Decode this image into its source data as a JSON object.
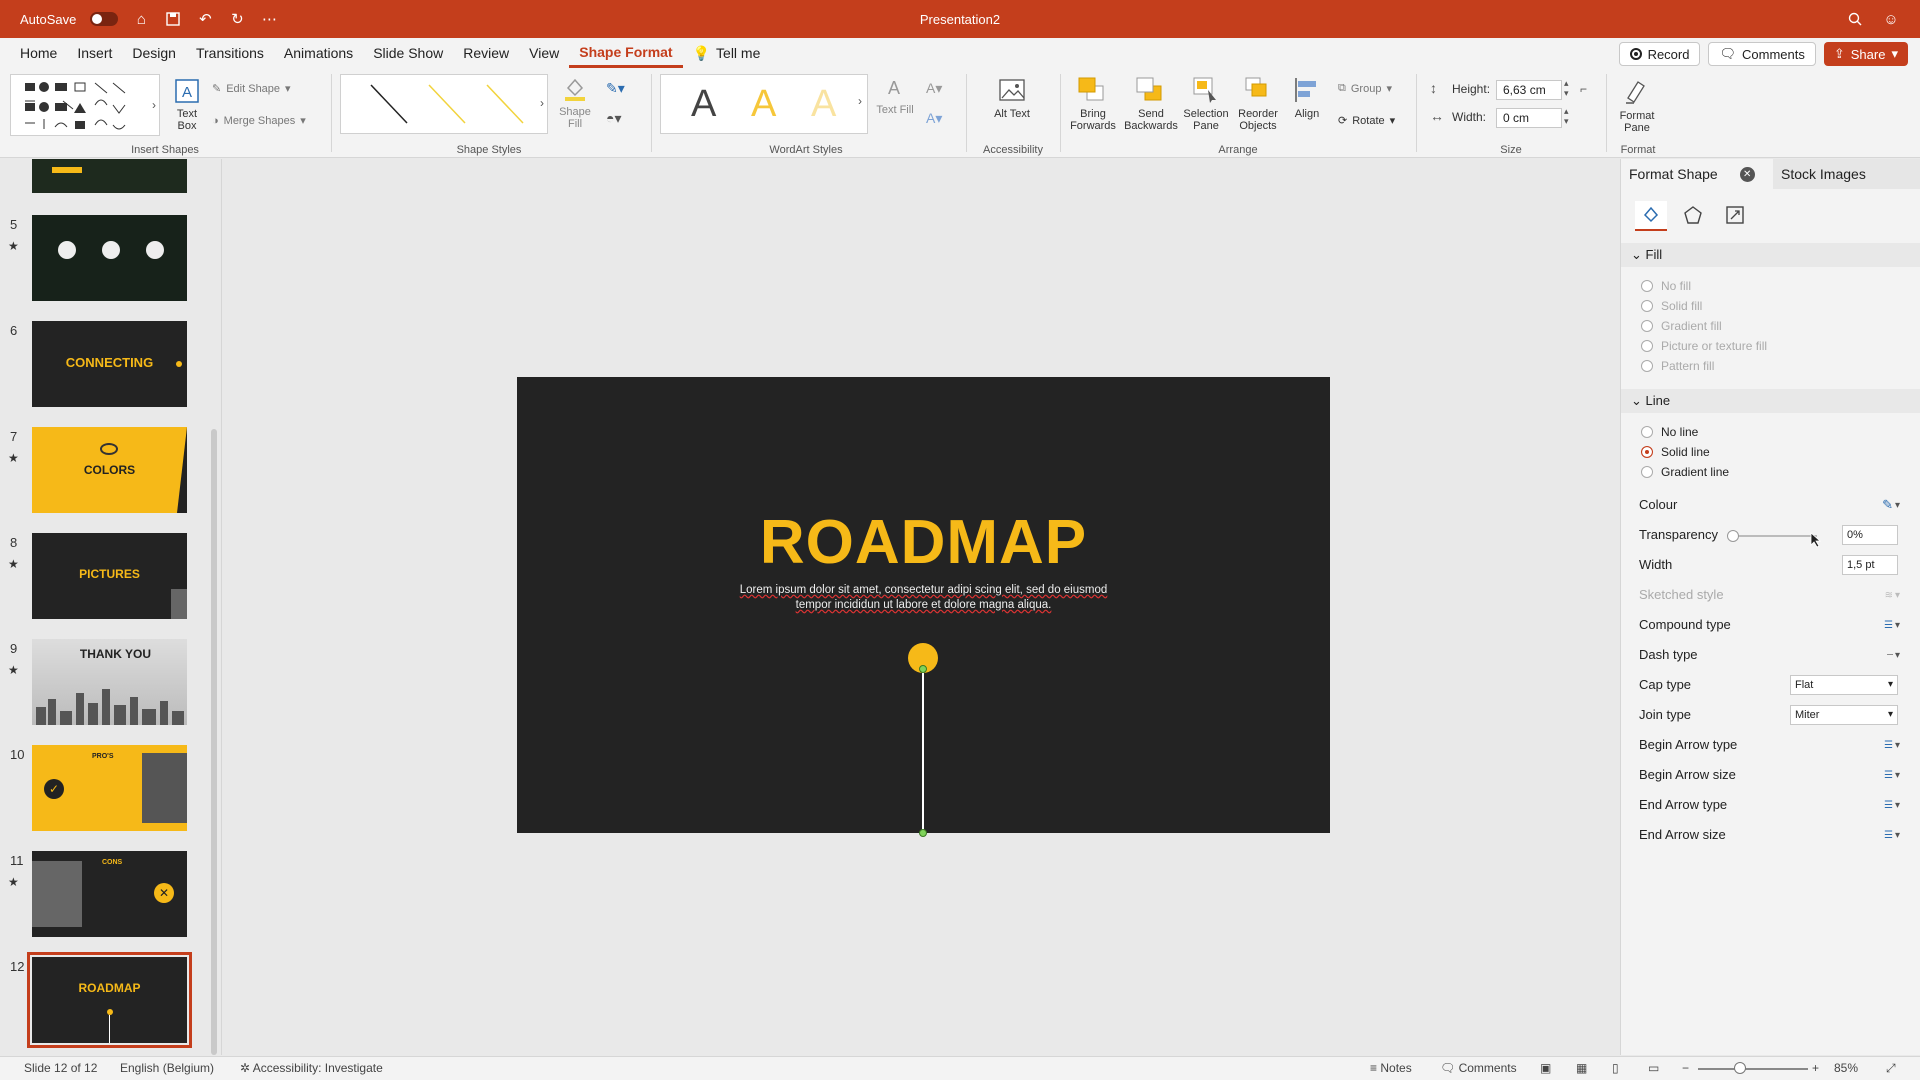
{
  "titlebar": {
    "autosave_label": "AutoSave",
    "doc_title": "Presentation2"
  },
  "tabs": [
    {
      "label": "Home"
    },
    {
      "label": "Insert"
    },
    {
      "label": "Design"
    },
    {
      "label": "Transitions"
    },
    {
      "label": "Animations"
    },
    {
      "label": "Slide Show"
    },
    {
      "label": "Review"
    },
    {
      "label": "View"
    },
    {
      "label": "Shape Format"
    }
  ],
  "tell_me": "Tell me",
  "actions": {
    "record": "Record",
    "comments": "Comments",
    "share": "Share"
  },
  "ribbon": {
    "insert_shapes": {
      "label": "Insert Shapes",
      "text_box": "Text Box",
      "edit_shape": "Edit Shape",
      "merge_shapes": "Merge Shapes"
    },
    "shape_styles": {
      "label": "Shape Styles",
      "shape_fill": "Shape Fill"
    },
    "wordart": {
      "label": "WordArt Styles",
      "text_fill": "Text Fill",
      "letter": "A"
    },
    "accessibility": {
      "label": "Accessibility",
      "alt_text": "Alt Text"
    },
    "arrange": {
      "label": "Arrange",
      "bring_forwards": "Bring Forwards",
      "send_backwards": "Send Backwards",
      "selection_pane": "Selection Pane",
      "reorder_objects": "Reorder Objects",
      "align": "Align",
      "group": "Group",
      "rotate": "Rotate"
    },
    "size": {
      "label": "Size",
      "height_label": "Height:",
      "height_value": "6,63 cm",
      "width_label": "Width:",
      "width_value": "0 cm"
    },
    "format": {
      "label": "Format",
      "format_pane": "Format Pane"
    }
  },
  "thumbnails": [
    {
      "num": "5",
      "star": true,
      "text": ""
    },
    {
      "num": "6",
      "star": false,
      "text": "CONNECTING"
    },
    {
      "num": "7",
      "star": true,
      "text": "COLORS"
    },
    {
      "num": "8",
      "star": true,
      "text": "PICTURES"
    },
    {
      "num": "9",
      "star": true,
      "text": "THANK YOU"
    },
    {
      "num": "10",
      "star": false,
      "text": "PRO'S"
    },
    {
      "num": "11",
      "star": true,
      "text": "CONS"
    },
    {
      "num": "12",
      "star": false,
      "text": "ROADMAP"
    }
  ],
  "slide": {
    "title": "ROADMAP",
    "body_1": "Lorem ipsum dolor sit amet, consectetur adipi scing elit, sed do eiusmod",
    "body_2": "tempor incididun ut labore et dolore magna aliqua."
  },
  "pane": {
    "title": "Format Shape",
    "stock": "Stock Images",
    "fill": {
      "header": "Fill",
      "options": [
        "No fill",
        "Solid fill",
        "Gradient fill",
        "Picture or texture fill",
        "Pattern fill"
      ]
    },
    "line": {
      "header": "Line",
      "options": [
        "No line",
        "Solid line",
        "Gradient line"
      ],
      "selected": "Solid line"
    },
    "props": {
      "colour": "Colour",
      "transparency": "Transparency",
      "transparency_value": "0%",
      "width": "Width",
      "width_value": "1,5 pt",
      "sketched": "Sketched style",
      "compound": "Compound type",
      "dash": "Dash type",
      "cap": "Cap type",
      "cap_value": "Flat",
      "join": "Join type",
      "join_value": "Miter",
      "begin_arrow_type": "Begin Arrow type",
      "begin_arrow_size": "Begin Arrow size",
      "end_arrow_type": "End Arrow type",
      "end_arrow_size": "End Arrow size"
    }
  },
  "statusbar": {
    "slide": "Slide 12 of 12",
    "language": "English (Belgium)",
    "accessibility": "Accessibility: Investigate",
    "notes": "Notes",
    "comments": "Comments",
    "zoom": "85%"
  },
  "colors": {
    "accent": "#c43e1c",
    "slide_bg": "#232323",
    "yellow": "#f6b918"
  }
}
